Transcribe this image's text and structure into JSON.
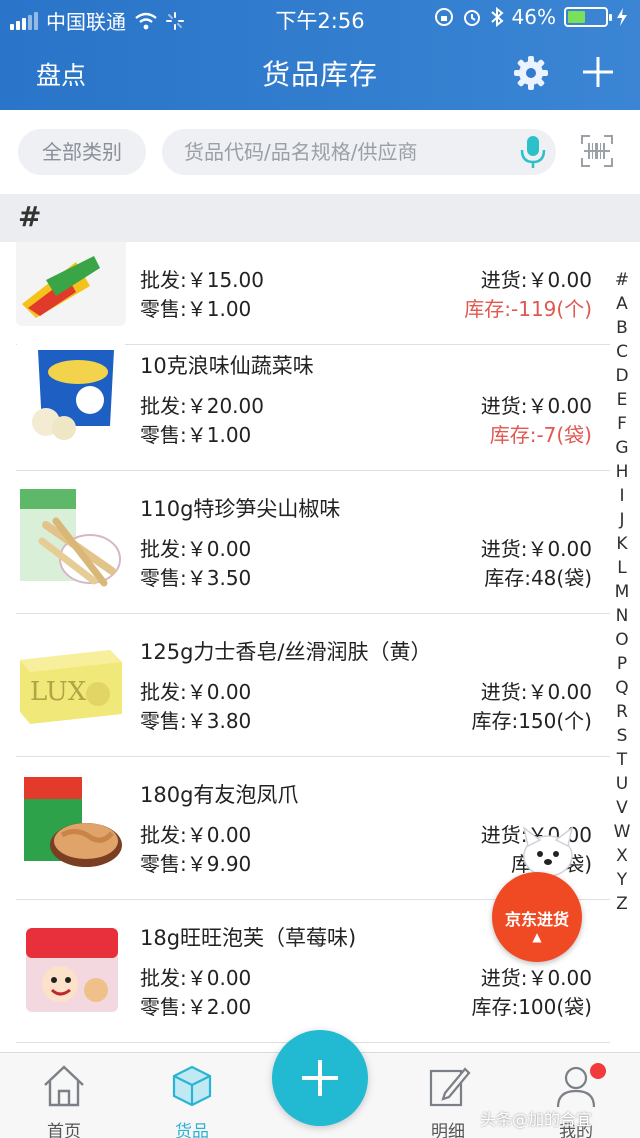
{
  "status_bar": {
    "carrier": "中国联通",
    "time": "下午2:56",
    "battery_percent": "46%",
    "battery_level": 0.46
  },
  "nav": {
    "left_action": "盘点",
    "title": "货品库存"
  },
  "search": {
    "category_label": "全部类别",
    "placeholder": "货品代码/品名规格/供应商"
  },
  "section": {
    "letter": "#"
  },
  "items": [
    {
      "name": "",
      "wholesale": "批发:￥15.00",
      "retail": "零售:￥1.00",
      "purchase": "进货:￥0.00",
      "stock": "库存:-119(个)",
      "negative": true
    },
    {
      "name": "10克浪味仙蔬菜味",
      "wholesale": "批发:￥20.00",
      "retail": "零售:￥1.00",
      "purchase": "进货:￥0.00",
      "stock": "库存:-7(袋)",
      "negative": true
    },
    {
      "name": "110g特珍笋尖山椒味",
      "wholesale": "批发:￥0.00",
      "retail": "零售:￥3.50",
      "purchase": "进货:￥0.00",
      "stock": "库存:48(袋)",
      "negative": false
    },
    {
      "name": "125g力士香皂/丝滑润肤（黄）",
      "wholesale": "批发:￥0.00",
      "retail": "零售:￥3.80",
      "purchase": "进货:￥0.00",
      "stock": "库存:150(个)",
      "negative": false
    },
    {
      "name": "180g有友泡凤爪",
      "wholesale": "批发:￥0.00",
      "retail": "零售:￥9.90",
      "purchase": "进货:￥0.00",
      "stock": "库存:    袋)",
      "negative": false
    },
    {
      "name": "18g旺旺泡芙（草莓味)",
      "wholesale": "批发:￥0.00",
      "retail": "零售:￥2.00",
      "purchase": "进货:￥0.00",
      "stock": "库存:100(袋)",
      "negative": false
    }
  ],
  "alphabet_index": [
    "#",
    "A",
    "B",
    "C",
    "D",
    "E",
    "F",
    "G",
    "H",
    "I",
    "J",
    "K",
    "L",
    "M",
    "N",
    "O",
    "P",
    "Q",
    "R",
    "S",
    "T",
    "U",
    "V",
    "W",
    "X",
    "Y",
    "Z"
  ],
  "floating_button": {
    "label": "京东进货",
    "arrow": "▲"
  },
  "tabs": [
    {
      "label": "首页",
      "icon": "home-icon",
      "active": false
    },
    {
      "label": "货品",
      "icon": "cube-icon",
      "active": true
    },
    {
      "label": "明细",
      "icon": "edit-icon",
      "active": false
    },
    {
      "label": "我的",
      "icon": "person-icon",
      "active": false
    }
  ],
  "watermark": "头条@加的合宜",
  "colors": {
    "header": "#2f7bcd",
    "accent": "#22b9d2",
    "negative_stock": "#e0584f",
    "jd_red": "#f04a24"
  }
}
